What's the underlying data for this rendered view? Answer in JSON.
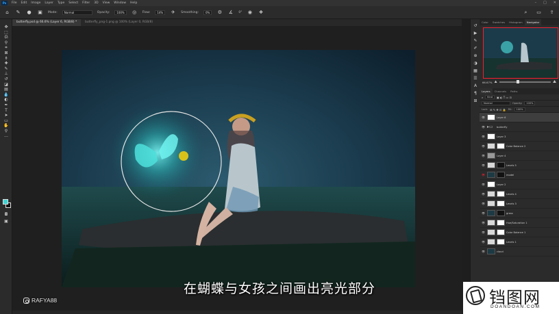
{
  "menu": {
    "items": [
      "File",
      "Edit",
      "Image",
      "Layer",
      "Type",
      "Select",
      "Filter",
      "3D",
      "View",
      "Window",
      "Help"
    ]
  },
  "options": {
    "mode_label": "Mode:",
    "mode_value": "Normal",
    "opacity_label": "Opacity:",
    "opacity_value": "100%",
    "flow_label": "Flow:",
    "flow_value": "14%",
    "smoothing_label": "Smoothing:",
    "smoothing_value": "0%",
    "angle_value": "0°"
  },
  "tabs": [
    {
      "label": "butterfly.psd @ 66.6% (Layer 6, RGB/8) *"
    },
    {
      "label": "butterfly_png-1.png @ 100% (Layer 0, RGB/8)"
    }
  ],
  "subtitle": "在蝴蝶与女孩之间画出亮光部分",
  "creator_handle": "RAFYA88",
  "panels": {
    "top_tabs": [
      "Color",
      "Swatches",
      "Histogram",
      "Navigator"
    ],
    "top_active": "Navigator",
    "zoom": "66.67%",
    "layers_tabs": [
      "Layers",
      "Channels",
      "Paths"
    ],
    "layers_active": "Layers",
    "kind_label": "Kind",
    "blend_mode": "Normal",
    "opacity_label": "Opacity:",
    "opacity_value": "100%",
    "lock_label": "Lock:",
    "fill_label": "Fill:",
    "fill_value": "100%"
  },
  "layers": [
    {
      "name": "Layer 6",
      "thumb": "white",
      "mask": "",
      "selected": true
    },
    {
      "name": "butterfly",
      "thumb": "folder",
      "mask": ""
    },
    {
      "name": "Layer 3",
      "thumb": "white",
      "mask": ""
    },
    {
      "name": "Color Balance 2",
      "thumb": "adj",
      "mask": "white"
    },
    {
      "name": "Layer 4",
      "thumb": "grey",
      "mask": ""
    },
    {
      "name": "Levels 5",
      "thumb": "adj",
      "mask": "black"
    },
    {
      "name": "model",
      "thumb": "dark",
      "mask": "black",
      "eye": "red"
    },
    {
      "name": "Layer 2",
      "thumb": "white",
      "mask": ""
    },
    {
      "name": "Levels 4",
      "thumb": "adj",
      "mask": "white"
    },
    {
      "name": "Levels 3",
      "thumb": "adj",
      "mask": "white"
    },
    {
      "name": "grass",
      "thumb": "dark",
      "mask": "black"
    },
    {
      "name": "Hue/Saturation 1",
      "thumb": "adj",
      "mask": "white"
    },
    {
      "name": "Color Balance 1",
      "thumb": "adj",
      "mask": "white"
    },
    {
      "name": "Levels 1",
      "thumb": "adj",
      "mask": "white"
    },
    {
      "name": "cloud",
      "thumb": "dark",
      "mask": ""
    }
  ],
  "watermark": {
    "title": "铛图网",
    "subtitle": "DOANDOAN.COM"
  },
  "colors": {
    "foreground": "#3fd4d4",
    "accent_red": "#ee2233",
    "brush_yellow": "#d8c21a"
  }
}
